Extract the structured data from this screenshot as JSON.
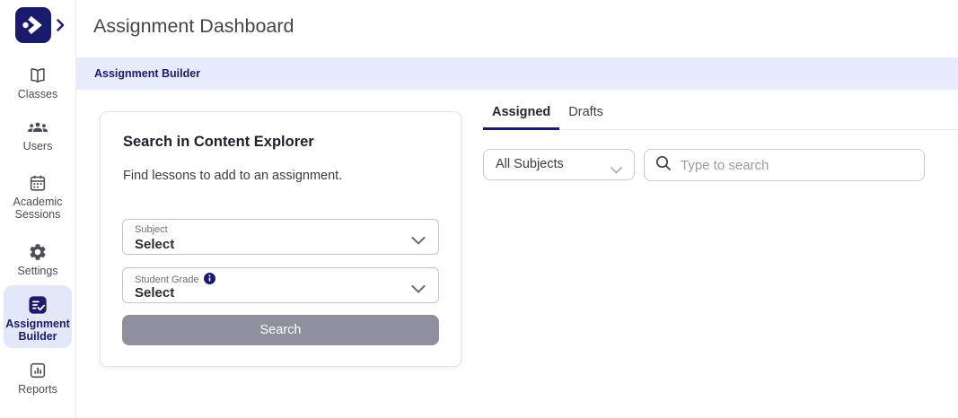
{
  "colors": {
    "brand_navy": "#1b1b6e",
    "banner_bg": "#e8ebfb",
    "active_item_bg": "#e4e7f8",
    "disabled_button_bg": "#8f8fa0"
  },
  "header": {
    "title": "Assignment Dashboard"
  },
  "banner": {
    "label": "Assignment Builder"
  },
  "sidebar": {
    "items": [
      {
        "label": "Classes"
      },
      {
        "label": "Users"
      },
      {
        "label": "Academic Sessions"
      },
      {
        "label": "Settings"
      },
      {
        "label": "Assignment Builder",
        "active": true
      },
      {
        "label": "Reports"
      }
    ]
  },
  "card": {
    "title": "Search in Content Explorer",
    "description": "Find lessons to add to an assignment.",
    "subject": {
      "label": "Subject",
      "value": "Select"
    },
    "student_grade": {
      "label": "Student Grade",
      "value": "Select"
    },
    "search_button": "Search"
  },
  "tabs": [
    {
      "label": "Assigned",
      "active": true
    },
    {
      "label": "Drafts",
      "active": false
    }
  ],
  "filters": {
    "subject_filter": "All Subjects",
    "search_placeholder": "Type to search"
  }
}
